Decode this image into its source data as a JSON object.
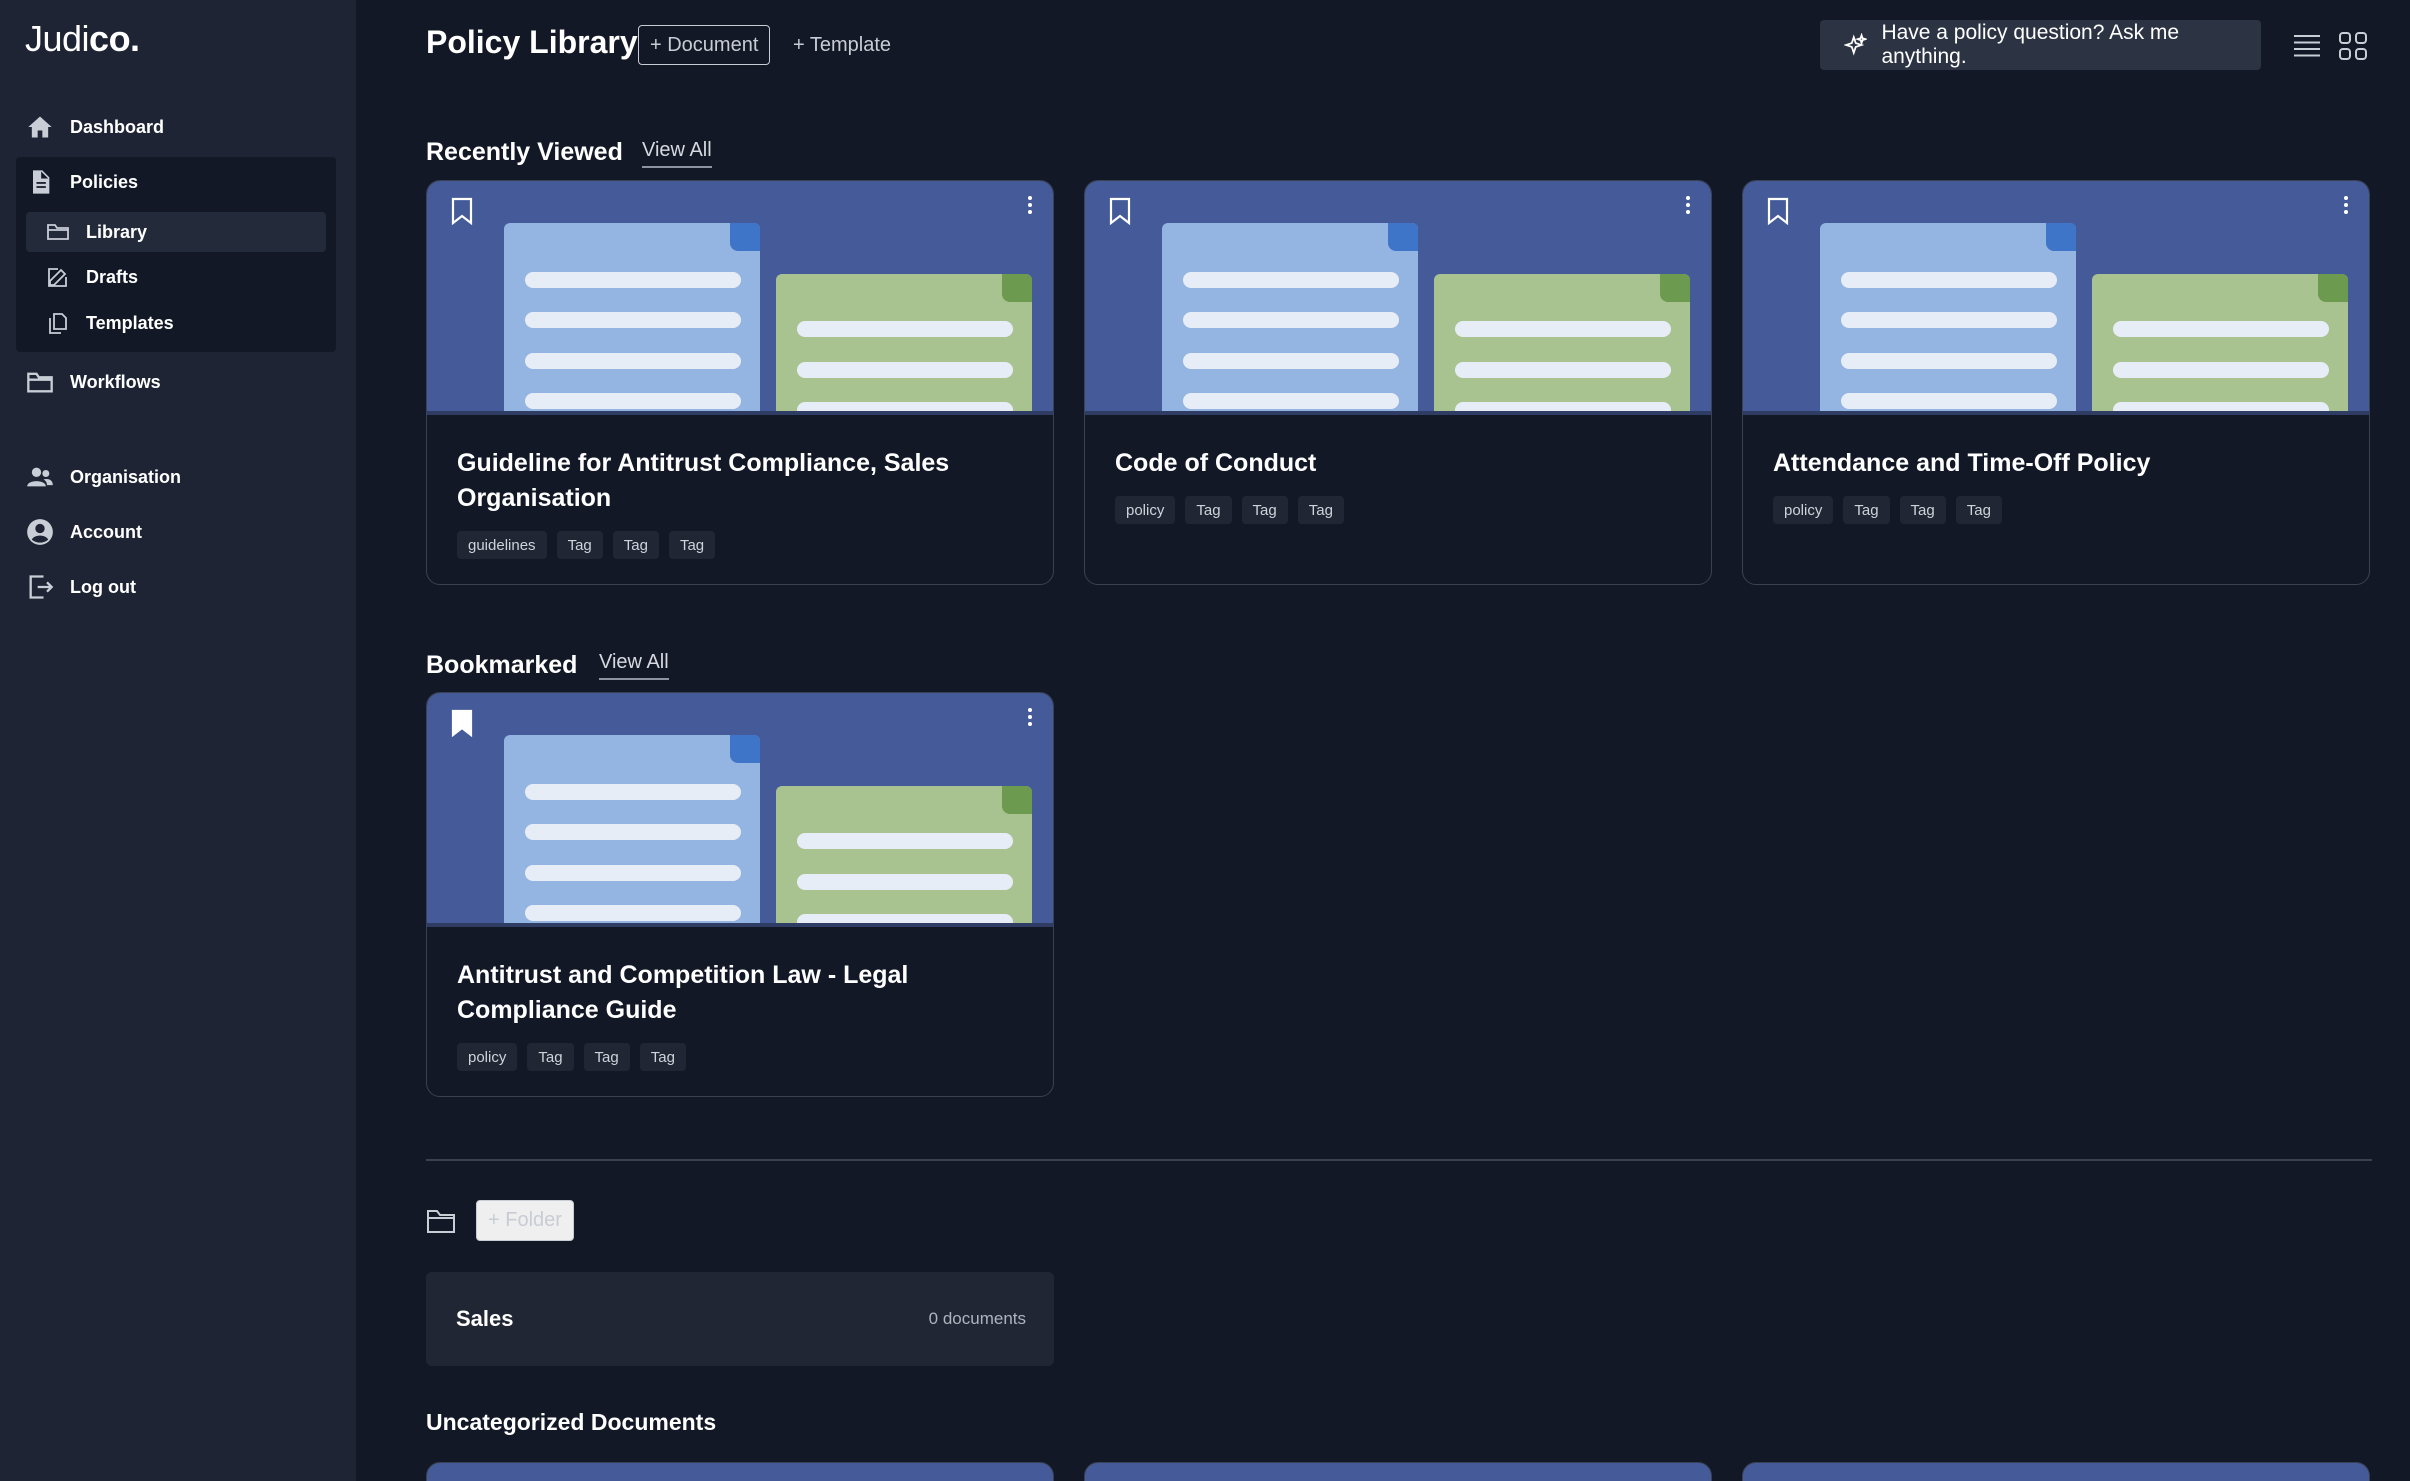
{
  "app": {
    "logo_regular": "Judi",
    "logo_bold": "co."
  },
  "sidebar": {
    "dashboard": "Dashboard",
    "policies": "Policies",
    "library": "Library",
    "drafts": "Drafts",
    "templates": "Templates",
    "workflows": "Workflows",
    "organisation": "Organisation",
    "account": "Account",
    "logout": "Log out"
  },
  "header": {
    "title": "Policy Library",
    "add_document": "+ Document",
    "add_template": "+ Template",
    "ask": "Have a policy question? Ask me anything."
  },
  "recently_viewed": {
    "title": "Recently Viewed",
    "view_all": "View All",
    "cards": [
      {
        "title": "Guideline for Antitrust Compliance, Sales Organisation",
        "tags": [
          "guidelines",
          "Tag",
          "Tag",
          "Tag"
        ],
        "bookmarked": false
      },
      {
        "title": "Code of Conduct",
        "tags": [
          "policy",
          "Tag",
          "Tag",
          "Tag"
        ],
        "bookmarked": false
      },
      {
        "title": "Attendance and Time-Off Policy",
        "tags": [
          "policy",
          "Tag",
          "Tag",
          "Tag"
        ],
        "bookmarked": false
      }
    ]
  },
  "bookmarked": {
    "title": "Bookmarked",
    "view_all": "View All",
    "cards": [
      {
        "title": "Antitrust and Competition Law - Legal Compliance Guide",
        "tags": [
          "policy",
          "Tag",
          "Tag",
          "Tag"
        ],
        "bookmarked": true
      }
    ]
  },
  "folders": {
    "add_folder": "+ Folder",
    "items": [
      {
        "name": "Sales",
        "count": "0 documents"
      }
    ]
  },
  "uncategorized": {
    "title": "Uncategorized Documents"
  },
  "colors": {
    "background": "#131826",
    "sidebar": "#1e2433",
    "thumbnail": "#455b99",
    "doc_blue": "#94b4e1",
    "doc_green": "#a8c38f"
  }
}
